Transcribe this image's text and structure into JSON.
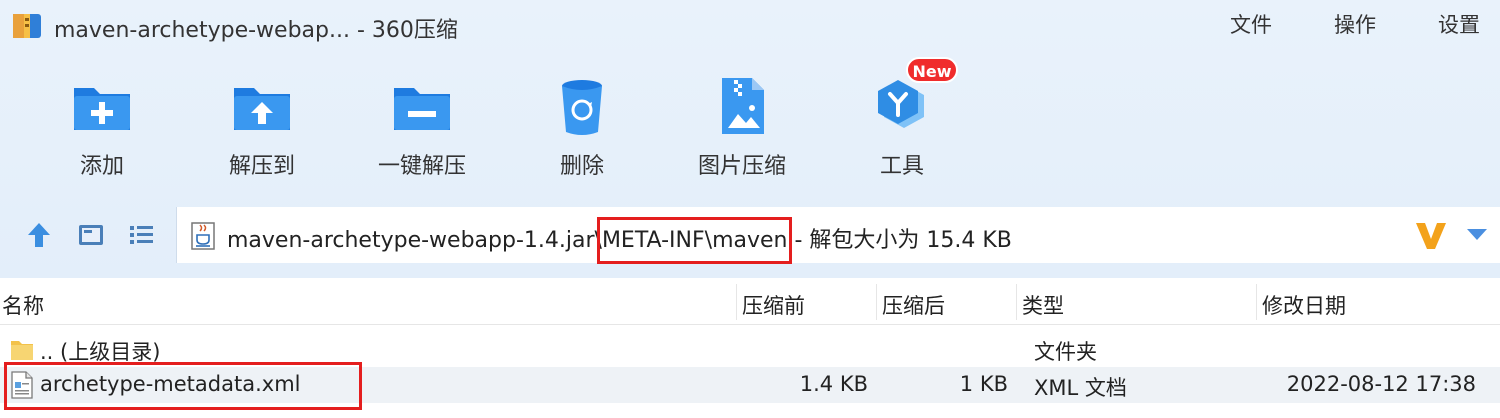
{
  "window": {
    "title": "maven-archetype-webap... - 360压缩",
    "menu": [
      "文件",
      "操作",
      "设置"
    ]
  },
  "toolbar": {
    "items": [
      {
        "label": "添加",
        "icon": "add-folder-icon"
      },
      {
        "label": "解压到",
        "icon": "extract-to-folder-icon"
      },
      {
        "label": "一键解压",
        "icon": "one-click-extract-icon"
      },
      {
        "label": "删除",
        "icon": "recycle-bin-icon"
      },
      {
        "label": "图片压缩",
        "icon": "image-compress-icon"
      },
      {
        "label": "工具",
        "icon": "tools-icon"
      }
    ],
    "new_badge": "New"
  },
  "address": {
    "path_prefix": "maven-archetype-webapp-1.4.jar\\",
    "path_highlight": "META-INF\\maven",
    "size_info": " - 解包大小为 15.4 KB"
  },
  "columns": {
    "name": "名称",
    "before": "压缩前",
    "after": "压缩后",
    "type": "类型",
    "modified": "修改日期"
  },
  "rows": [
    {
      "name": ".. (上级目录)",
      "before": "",
      "after": "",
      "type": "文件夹",
      "modified": ""
    },
    {
      "name": "archetype-metadata.xml",
      "before": "1.4 KB",
      "after": "1 KB",
      "type": "XML 文档",
      "modified": "2022-08-12 17:38"
    }
  ],
  "colors": {
    "accent": "#2f8de4",
    "highlight_box": "#e41e1e",
    "new_badge": "#f02c2c"
  }
}
